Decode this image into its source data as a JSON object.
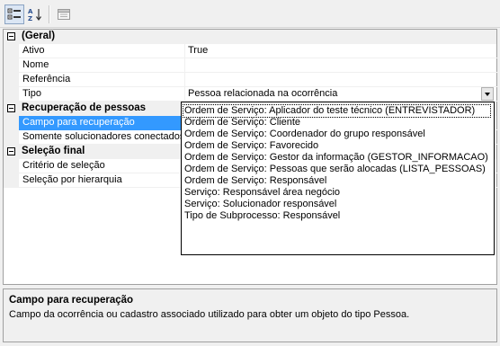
{
  "toolbar": {
    "categorized": "categorized-view",
    "alphabetical": "sort-alphabetical",
    "pages": "property-pages"
  },
  "grid": {
    "geral": {
      "title": "(Geral)",
      "props": [
        {
          "name": "Ativo",
          "value": "True"
        },
        {
          "name": "Nome",
          "value": ""
        },
        {
          "name": "Referência",
          "value": ""
        },
        {
          "name": "Tipo",
          "value": "Pessoa relacionada na ocorrência"
        }
      ]
    },
    "recuperacao": {
      "title": "Recuperação de pessoas",
      "props": [
        {
          "name": "Campo para recuperação",
          "value": ""
        },
        {
          "name": "Somente solucionadores conectados",
          "value": ""
        }
      ]
    },
    "selecao": {
      "title": "Seleção final",
      "props": [
        {
          "name": "Critério de seleção",
          "value": ""
        },
        {
          "name": "Seleção por hierarquia",
          "value": ""
        }
      ]
    }
  },
  "dropdown": {
    "options": [
      "Ordem de Serviço: Aplicador do teste técnico (ENTREVISTADOR)",
      "Ordem de Serviço: Cliente",
      "Ordem de Serviço: Coordenador do grupo responsável",
      "Ordem de Serviço: Favorecido",
      "Ordem de Serviço: Gestor da informação (GESTOR_INFORMACAO)",
      "Ordem de Serviço: Pessoas que serão alocadas (LISTA_PESSOAS)",
      "Ordem de Serviço: Responsável",
      "Serviço: Responsável área negócio",
      "Serviço: Solucionador responsável",
      "Tipo de Subprocesso: Responsável"
    ]
  },
  "help": {
    "title": "Campo para recuperação",
    "description": "Campo da ocorrência ou cadastro associado utilizado para obter um objeto do tipo Pessoa."
  }
}
